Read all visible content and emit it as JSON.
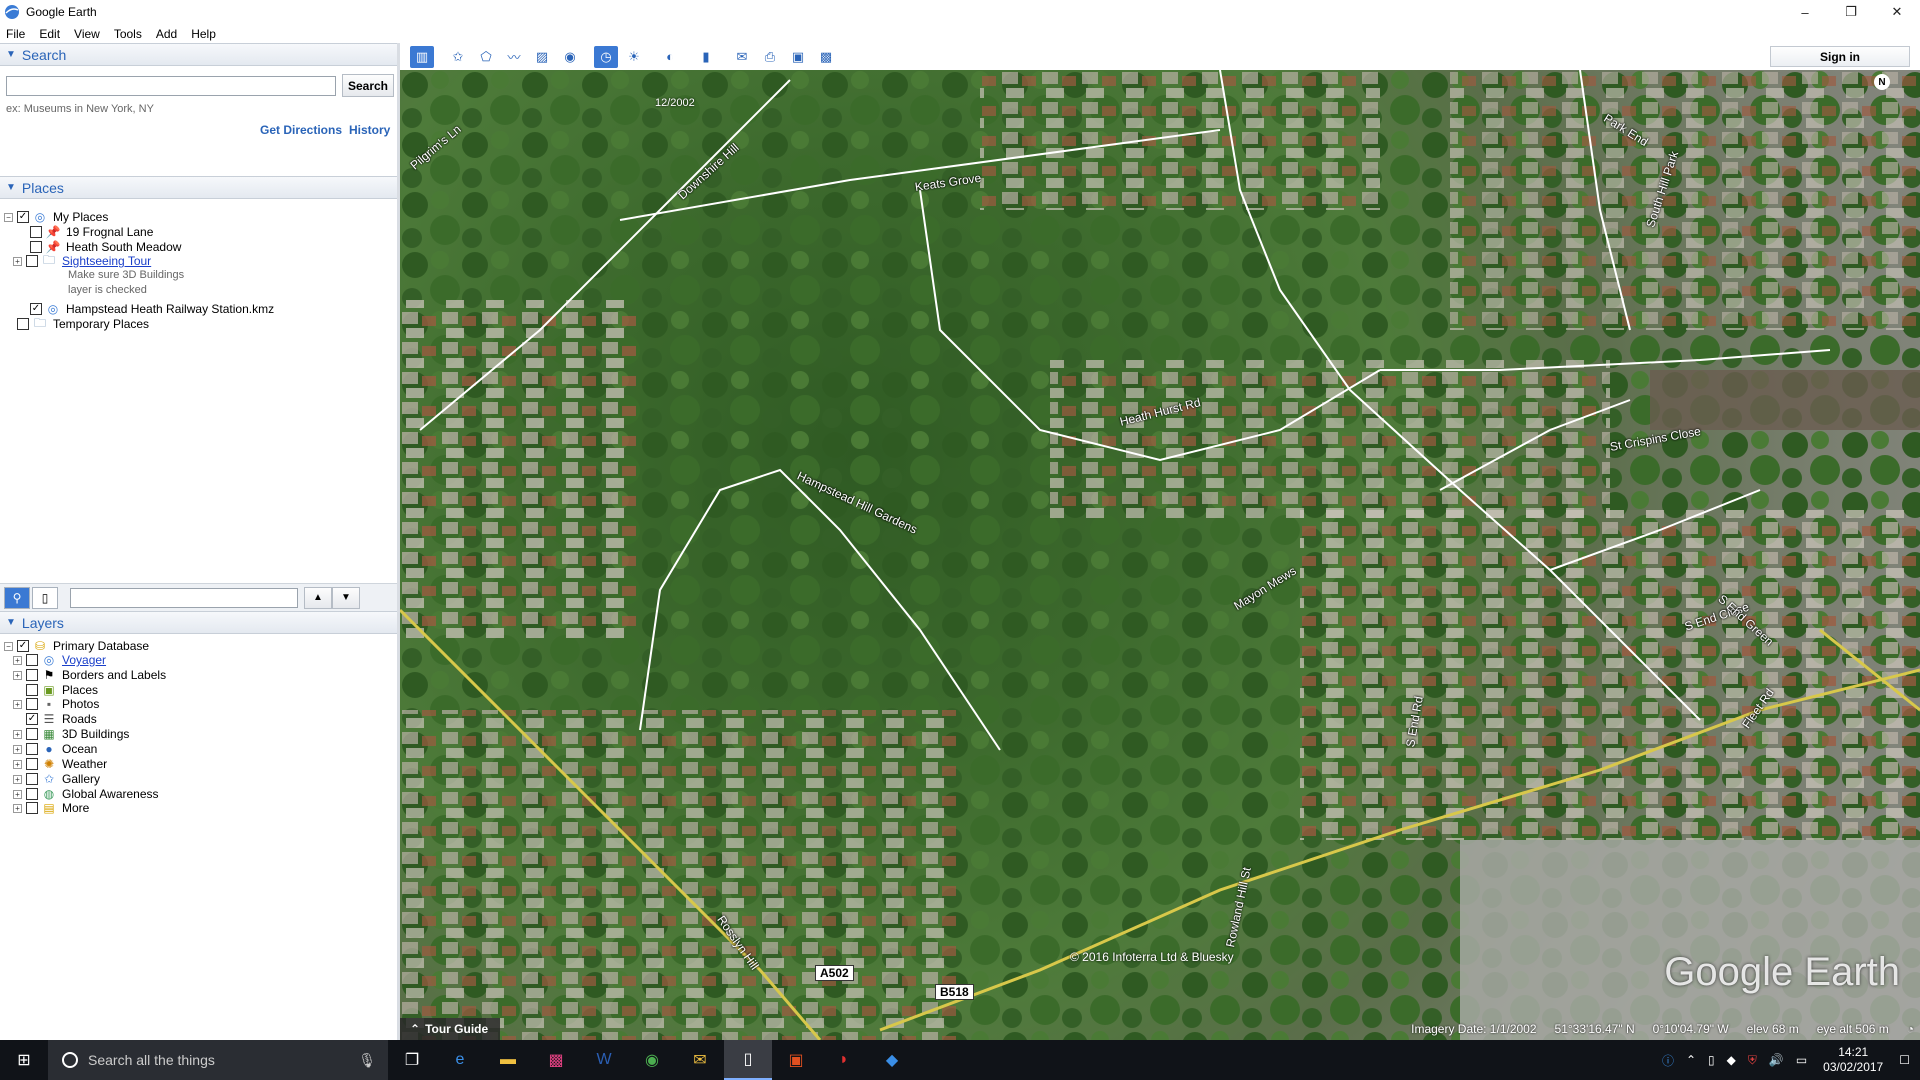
{
  "window": {
    "title": "Google Earth",
    "minimize": "–",
    "maximize": "❐",
    "close": "✕"
  },
  "menu": [
    "File",
    "Edit",
    "View",
    "Tools",
    "Add",
    "Help"
  ],
  "search": {
    "header": "Search",
    "input_value": "",
    "button": "Search",
    "hint": "ex: Museums in New York, NY",
    "get_directions": "Get Directions",
    "history": "History"
  },
  "places": {
    "header": "Places",
    "my_places": "My Places",
    "item1": "19 Frognal Lane",
    "item2": "Heath South Meadow",
    "item3": "Sightseeing Tour",
    "item3_note1": "Make sure 3D Buildings",
    "item3_note2": "layer is checked",
    "item4": "Hampstead Heath Railway Station.kmz",
    "temporary": "Temporary Places"
  },
  "layers": {
    "header": "Layers",
    "primary": "Primary Database",
    "items": [
      "Voyager",
      "Borders and Labels",
      "Places",
      "Photos",
      "Roads",
      "3D Buildings",
      "Ocean",
      "Weather",
      "Gallery",
      "Global Awareness",
      "More"
    ]
  },
  "toolbar": {
    "sign_in": "Sign in"
  },
  "map": {
    "date_label": "12/2002",
    "compass": "N",
    "streets": [
      "Pilgrim's Ln",
      "Downshire Hill",
      "Keats Grove",
      "Park End",
      "South Hill Park",
      "Heath Hurst Rd",
      "St Crispins Close",
      "Hampstead Hill Gardens",
      "Mayon Mews",
      "S End Close",
      "S End Green",
      "S End Rd",
      "Fleet Rd",
      "Rosslyn Hill",
      "Rowland Hill St"
    ],
    "shields": [
      "A502",
      "B518"
    ],
    "copyright": "© 2016 Infoterra Ltd & Bluesky",
    "watermark": "Google Earth",
    "tour_guide": "Tour Guide",
    "imagery_date": "Imagery Date: 1/1/2002",
    "lat": "51°33'16.47\" N",
    "lon": "0°10'04.79\" W",
    "elev": "elev  68 m",
    "eye_alt": "eye alt  506 m"
  },
  "taskbar": {
    "search_placeholder": "Search all the things",
    "time": "14:21",
    "date": "03/02/2017"
  }
}
